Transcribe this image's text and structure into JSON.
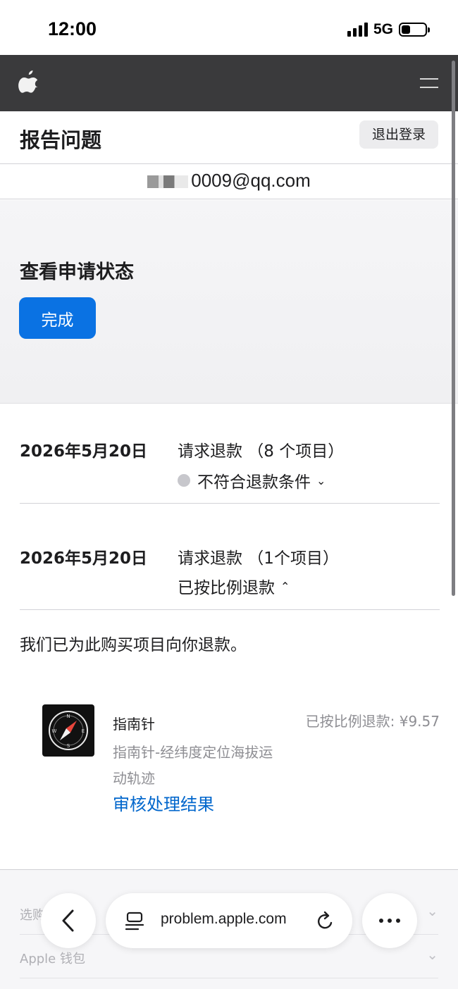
{
  "status_bar": {
    "time": "12:00",
    "network": "5G"
  },
  "header": {
    "title": "报告问题",
    "signout_label": "退出登录"
  },
  "account": {
    "email_visible": "0009@qq.com"
  },
  "panel": {
    "heading": "查看申请状态",
    "done_label": "完成"
  },
  "requests": [
    {
      "date": "2026年5月20日",
      "title": "请求退款 （8 个项目）",
      "status": "不符合退款条件",
      "expanded": false
    },
    {
      "date": "2026年5月20日",
      "title": "请求退款 （1个项目）",
      "status": "已按比例退款",
      "expanded": true
    }
  ],
  "refund_message": "我们已为此购买项目向你退款。",
  "item": {
    "name": "指南针",
    "subtitle": "指南针-经纬度定位海拔运动轨迹",
    "refund_label": "已按比例退款:",
    "refund_amount": "¥9.57",
    "link": "审核处理结果"
  },
  "ghost_rows": [
    {
      "label": "选购"
    },
    {
      "label": "Apple 钱包"
    }
  ],
  "browser": {
    "address": "problem.apple.com"
  },
  "colors": {
    "nav": "#3a3a3c",
    "accent": "#0a72e3",
    "link": "#0066cc"
  }
}
